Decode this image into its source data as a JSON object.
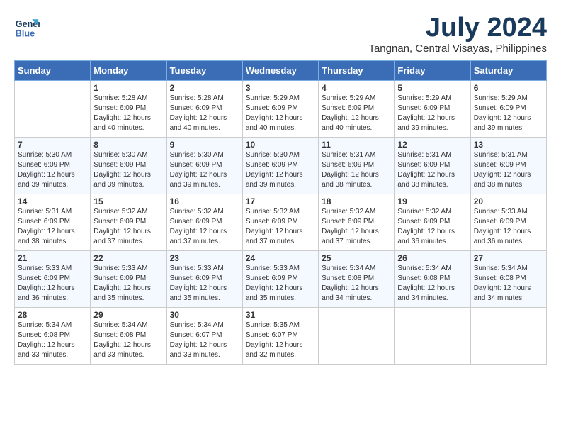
{
  "logo": {
    "line1": "General",
    "line2": "Blue"
  },
  "title": "July 2024",
  "location": "Tangnan, Central Visayas, Philippines",
  "weekdays": [
    "Sunday",
    "Monday",
    "Tuesday",
    "Wednesday",
    "Thursday",
    "Friday",
    "Saturday"
  ],
  "weeks": [
    [
      {
        "day": "",
        "sunrise": "",
        "sunset": "",
        "daylight": ""
      },
      {
        "day": "1",
        "sunrise": "Sunrise: 5:28 AM",
        "sunset": "Sunset: 6:09 PM",
        "daylight": "Daylight: 12 hours and 40 minutes."
      },
      {
        "day": "2",
        "sunrise": "Sunrise: 5:28 AM",
        "sunset": "Sunset: 6:09 PM",
        "daylight": "Daylight: 12 hours and 40 minutes."
      },
      {
        "day": "3",
        "sunrise": "Sunrise: 5:29 AM",
        "sunset": "Sunset: 6:09 PM",
        "daylight": "Daylight: 12 hours and 40 minutes."
      },
      {
        "day": "4",
        "sunrise": "Sunrise: 5:29 AM",
        "sunset": "Sunset: 6:09 PM",
        "daylight": "Daylight: 12 hours and 40 minutes."
      },
      {
        "day": "5",
        "sunrise": "Sunrise: 5:29 AM",
        "sunset": "Sunset: 6:09 PM",
        "daylight": "Daylight: 12 hours and 39 minutes."
      },
      {
        "day": "6",
        "sunrise": "Sunrise: 5:29 AM",
        "sunset": "Sunset: 6:09 PM",
        "daylight": "Daylight: 12 hours and 39 minutes."
      }
    ],
    [
      {
        "day": "7",
        "sunrise": "Sunrise: 5:30 AM",
        "sunset": "Sunset: 6:09 PM",
        "daylight": "Daylight: 12 hours and 39 minutes."
      },
      {
        "day": "8",
        "sunrise": "Sunrise: 5:30 AM",
        "sunset": "Sunset: 6:09 PM",
        "daylight": "Daylight: 12 hours and 39 minutes."
      },
      {
        "day": "9",
        "sunrise": "Sunrise: 5:30 AM",
        "sunset": "Sunset: 6:09 PM",
        "daylight": "Daylight: 12 hours and 39 minutes."
      },
      {
        "day": "10",
        "sunrise": "Sunrise: 5:30 AM",
        "sunset": "Sunset: 6:09 PM",
        "daylight": "Daylight: 12 hours and 39 minutes."
      },
      {
        "day": "11",
        "sunrise": "Sunrise: 5:31 AM",
        "sunset": "Sunset: 6:09 PM",
        "daylight": "Daylight: 12 hours and 38 minutes."
      },
      {
        "day": "12",
        "sunrise": "Sunrise: 5:31 AM",
        "sunset": "Sunset: 6:09 PM",
        "daylight": "Daylight: 12 hours and 38 minutes."
      },
      {
        "day": "13",
        "sunrise": "Sunrise: 5:31 AM",
        "sunset": "Sunset: 6:09 PM",
        "daylight": "Daylight: 12 hours and 38 minutes."
      }
    ],
    [
      {
        "day": "14",
        "sunrise": "Sunrise: 5:31 AM",
        "sunset": "Sunset: 6:09 PM",
        "daylight": "Daylight: 12 hours and 38 minutes."
      },
      {
        "day": "15",
        "sunrise": "Sunrise: 5:32 AM",
        "sunset": "Sunset: 6:09 PM",
        "daylight": "Daylight: 12 hours and 37 minutes."
      },
      {
        "day": "16",
        "sunrise": "Sunrise: 5:32 AM",
        "sunset": "Sunset: 6:09 PM",
        "daylight": "Daylight: 12 hours and 37 minutes."
      },
      {
        "day": "17",
        "sunrise": "Sunrise: 5:32 AM",
        "sunset": "Sunset: 6:09 PM",
        "daylight": "Daylight: 12 hours and 37 minutes."
      },
      {
        "day": "18",
        "sunrise": "Sunrise: 5:32 AM",
        "sunset": "Sunset: 6:09 PM",
        "daylight": "Daylight: 12 hours and 37 minutes."
      },
      {
        "day": "19",
        "sunrise": "Sunrise: 5:32 AM",
        "sunset": "Sunset: 6:09 PM",
        "daylight": "Daylight: 12 hours and 36 minutes."
      },
      {
        "day": "20",
        "sunrise": "Sunrise: 5:33 AM",
        "sunset": "Sunset: 6:09 PM",
        "daylight": "Daylight: 12 hours and 36 minutes."
      }
    ],
    [
      {
        "day": "21",
        "sunrise": "Sunrise: 5:33 AM",
        "sunset": "Sunset: 6:09 PM",
        "daylight": "Daylight: 12 hours and 36 minutes."
      },
      {
        "day": "22",
        "sunrise": "Sunrise: 5:33 AM",
        "sunset": "Sunset: 6:09 PM",
        "daylight": "Daylight: 12 hours and 35 minutes."
      },
      {
        "day": "23",
        "sunrise": "Sunrise: 5:33 AM",
        "sunset": "Sunset: 6:09 PM",
        "daylight": "Daylight: 12 hours and 35 minutes."
      },
      {
        "day": "24",
        "sunrise": "Sunrise: 5:33 AM",
        "sunset": "Sunset: 6:09 PM",
        "daylight": "Daylight: 12 hours and 35 minutes."
      },
      {
        "day": "25",
        "sunrise": "Sunrise: 5:34 AM",
        "sunset": "Sunset: 6:08 PM",
        "daylight": "Daylight: 12 hours and 34 minutes."
      },
      {
        "day": "26",
        "sunrise": "Sunrise: 5:34 AM",
        "sunset": "Sunset: 6:08 PM",
        "daylight": "Daylight: 12 hours and 34 minutes."
      },
      {
        "day": "27",
        "sunrise": "Sunrise: 5:34 AM",
        "sunset": "Sunset: 6:08 PM",
        "daylight": "Daylight: 12 hours and 34 minutes."
      }
    ],
    [
      {
        "day": "28",
        "sunrise": "Sunrise: 5:34 AM",
        "sunset": "Sunset: 6:08 PM",
        "daylight": "Daylight: 12 hours and 33 minutes."
      },
      {
        "day": "29",
        "sunrise": "Sunrise: 5:34 AM",
        "sunset": "Sunset: 6:08 PM",
        "daylight": "Daylight: 12 hours and 33 minutes."
      },
      {
        "day": "30",
        "sunrise": "Sunrise: 5:34 AM",
        "sunset": "Sunset: 6:07 PM",
        "daylight": "Daylight: 12 hours and 33 minutes."
      },
      {
        "day": "31",
        "sunrise": "Sunrise: 5:35 AM",
        "sunset": "Sunset: 6:07 PM",
        "daylight": "Daylight: 12 hours and 32 minutes."
      },
      {
        "day": "",
        "sunrise": "",
        "sunset": "",
        "daylight": ""
      },
      {
        "day": "",
        "sunrise": "",
        "sunset": "",
        "daylight": ""
      },
      {
        "day": "",
        "sunrise": "",
        "sunset": "",
        "daylight": ""
      }
    ]
  ]
}
